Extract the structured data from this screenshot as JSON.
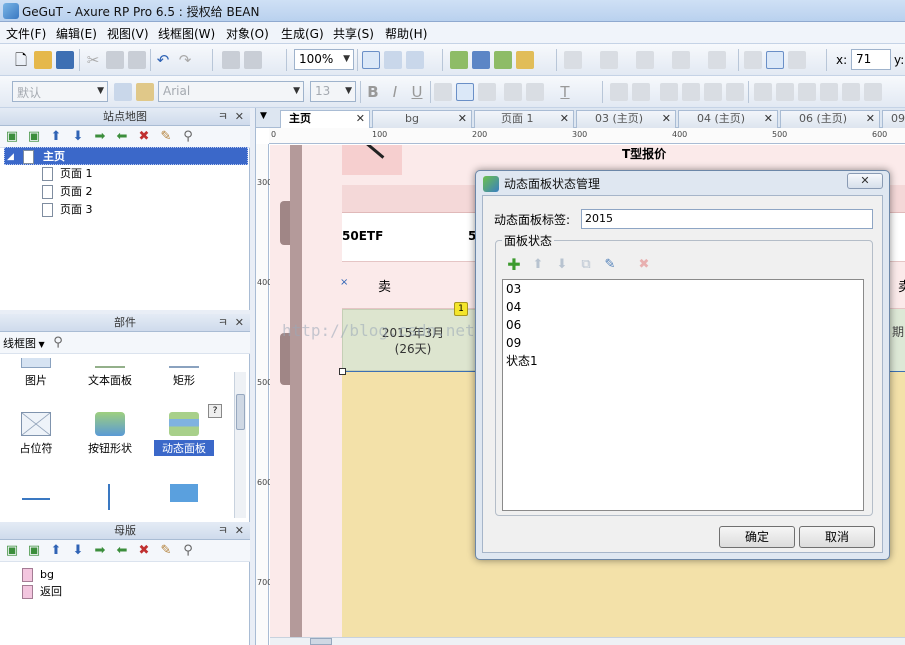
{
  "window": {
    "title": "GeGuT - Axure RP Pro 6.5 : 授权给 BEAN"
  },
  "menu": [
    "文件(F)",
    "编辑(E)",
    "视图(V)",
    "线框图(W)",
    "对象(O)",
    "生成(G)",
    "共享(S)",
    "帮助(H)"
  ],
  "toolbar": {
    "zoom": "100%",
    "x_label": "x:",
    "x_value": "71",
    "y_label": "y:",
    "style_combo": "默认",
    "font_combo": "Arial",
    "size_combo": "13"
  },
  "sitemap": {
    "title": "站点地图",
    "pin": "ㅋ",
    "close": "✕",
    "pages": [
      {
        "label": "主页"
      },
      {
        "label": "页面 1"
      },
      {
        "label": "页面 2"
      },
      {
        "label": "页面 3"
      }
    ]
  },
  "widgets": {
    "title": "部件",
    "library": "线框图",
    "items": [
      {
        "label": "图片"
      },
      {
        "label": "文本面板"
      },
      {
        "label": "矩形"
      },
      {
        "label": "占位符"
      },
      {
        "label": "按钮形状"
      },
      {
        "label": "动态面板"
      }
    ],
    "help": "?"
  },
  "masters": {
    "title": "母版",
    "items": [
      {
        "label": "bg"
      },
      {
        "label": "返回"
      }
    ]
  },
  "tabs": [
    {
      "label": "主页"
    },
    {
      "label": "bg"
    },
    {
      "label": "页面 1"
    },
    {
      "label": "03 (主页)"
    },
    {
      "label": "04 (主页)"
    },
    {
      "label": "06 (主页)"
    },
    {
      "label": "09"
    }
  ],
  "tab_close": "✕",
  "rulers": {
    "h": [
      "0",
      "100",
      "200",
      "300",
      "400",
      "500",
      "600"
    ],
    "v": [
      "300",
      "400",
      "500",
      "600",
      "700"
    ]
  },
  "canvas": {
    "header_text": "T型报价",
    "etf_label": "50ETF",
    "etf_label2": "5",
    "sell_label": "卖",
    "sell_label2": "卖",
    "date_line1": "2015年3月",
    "date_line2": "(26天)",
    "right_char": "期",
    "badge": "1",
    "watermark": "http://blog.csdn.net/robinson_911",
    "watermark_mask": "http://bl",
    "watermark_tail": "n.net/robinson_911"
  },
  "dialog": {
    "title": "动态面板状态管理",
    "close": "✕",
    "label_caption": "动态面板标签:",
    "label_value": "2015",
    "group_title": "面板状态",
    "states": [
      "03",
      "04",
      "06",
      "09",
      "状态1"
    ],
    "ok": "确定",
    "cancel": "取消"
  },
  "colors": {
    "selection": "#3b68c9",
    "canvas_bg": "#fbeaea",
    "panel_band": "#f3e1a9"
  }
}
